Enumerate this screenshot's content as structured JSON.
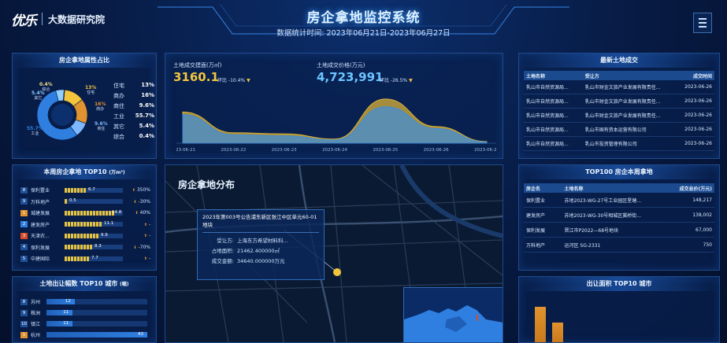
{
  "header": {
    "logo": "优乐",
    "org": "大数据研究院",
    "title": "房企拿地监控系统",
    "subtitle": "数据统计时间:  2023年06月21日-2023年06月27日"
  },
  "attr_panel": {
    "title": "房企拿地属性占比",
    "legend": [
      {
        "label": "住宅",
        "value": "13%"
      },
      {
        "label": "商办",
        "value": "16%"
      },
      {
        "label": "商住",
        "value": "9.6%"
      },
      {
        "label": "工业",
        "value": "55.7%"
      },
      {
        "label": "其它",
        "value": "5.4%"
      },
      {
        "label": "综合",
        "value": "0.4%"
      }
    ],
    "donut_labels": [
      {
        "value": "0.4%",
        "label": "综合"
      },
      {
        "value": "5.4%",
        "label": "其它"
      },
      {
        "value": "13%",
        "label": "住宅"
      },
      {
        "value": "16%",
        "label": "商办"
      },
      {
        "value": "9.6%",
        "label": "商住"
      },
      {
        "value": "55.7%",
        "label": "工业"
      }
    ],
    "colors": [
      "#f2c53d",
      "#e0932e",
      "#7bb8ff",
      "#2f7fe0",
      "#8fd0ff",
      "#f7e28a"
    ]
  },
  "chart_panel": {
    "area_label": "土地成交建面(万㎡)",
    "area_value": "3160.1",
    "area_change": "环比 -10.4%",
    "price_label": "土地成交价格(万元)",
    "price_value": "4,723,991",
    "price_change": "环比 -26.5%"
  },
  "chart_data": {
    "type": "area",
    "categories": [
      "2023-06-21",
      "2023-06-22",
      "2023-06-23",
      "2023-06-24",
      "2023-06-25",
      "2023-06-26",
      "2023-06-27"
    ],
    "series": [
      {
        "values": [
          60,
          20,
          18,
          8,
          85,
          32,
          3
        ],
        "color": "#d8b23a"
      },
      {
        "values": [
          55,
          16,
          14,
          6,
          70,
          28,
          2
        ],
        "color": "#3d8ee0"
      }
    ],
    "ylim": [
      0,
      100
    ]
  },
  "latest_panel": {
    "title": "最新土地成交",
    "columns": [
      "土地名称",
      "受让方",
      "成交时间"
    ],
    "rows": [
      [
        "乳山市自然资源局...",
        "乳山市财金文旅产业发展有限责任...",
        "2023-06-26"
      ],
      [
        "乳山市自然资源局...",
        "乳山市财金文旅产业发展有限责任...",
        "2023-06-26"
      ],
      [
        "乳山市自然资源局...",
        "乳山市财金文旅产业发展有限责任...",
        "2023-06-26"
      ],
      [
        "乳山市自然资源局...",
        "乳山市国有资本运营有限公司",
        "2023-06-26"
      ],
      [
        "乳山市自然资源局...",
        "乳山市投资管理有限公司",
        "2023-06-26"
      ]
    ]
  },
  "top10_panel": {
    "title": "本周房企拿地 TOP10",
    "unit": "(万m²)",
    "rows": [
      {
        "rank": "8",
        "name": "保利置业",
        "value": "6.7",
        "change": "350%",
        "dir": "up",
        "fill": 0.45,
        "rank_color": "#1f4f96"
      },
      {
        "rank": "9",
        "name": "万科地产",
        "value": "0.5",
        "change": "-30%",
        "dir": "down",
        "fill": 0.04,
        "rank_color": "#1f4f96"
      },
      {
        "rank": "1",
        "name": "城建发展",
        "value": "14.8",
        "change": "40%",
        "dir": "up",
        "fill": 1.0,
        "rank_color": "#e0932e"
      },
      {
        "rank": "2",
        "name": "建发房产",
        "value": "11.1",
        "change": "-",
        "dir": "none",
        "fill": 0.75,
        "rank_color": "#2f7fe0"
      },
      {
        "rank": "3",
        "name": "天津农...",
        "value": "9.9",
        "change": "-",
        "dir": "none",
        "fill": 0.67,
        "rank_color": "#d84b2a"
      },
      {
        "rank": "4",
        "name": "保利发展",
        "value": "8.3",
        "change": "-70%",
        "dir": "down",
        "fill": 0.56,
        "rank_color": "#1f4f96"
      },
      {
        "rank": "5",
        "name": "中建国际",
        "value": "7.7",
        "change": "-",
        "dir": "none",
        "fill": 0.52,
        "rank_color": "#1f4f96"
      }
    ]
  },
  "map_panel": {
    "title": "房企拿地分布",
    "popup_title": "2023年第003号公告浦东新区张江中区单元60-01地块",
    "fields": [
      {
        "label": "受让方:",
        "value": "上海东方希望材料科..."
      },
      {
        "label": "占地面积:",
        "value": "21462.400000㎡"
      },
      {
        "label": "成交金额:",
        "value": "34640.000000万元"
      }
    ]
  },
  "top100_panel": {
    "title": "TOP100 房企本周拿地",
    "columns": [
      "房企名",
      "土地名称",
      "成交总价(万元)"
    ],
    "rows": [
      [
        "保利置业",
        "苏地2023-WG-27号工业园区星塘...",
        "148,217"
      ],
      [
        "建发房产",
        "苏地2023-WG-30号相城区冀桥街...",
        "138,002"
      ],
      [
        "保利发展",
        "晋江市P2022—68号地块",
        "67,000"
      ],
      [
        "万科地产",
        "运河区 SG-2331",
        "750"
      ]
    ]
  },
  "city_panel": {
    "title": "土地出让幅数 TOP10 城市",
    "unit": "(幅)",
    "rows": [
      {
        "rank": "8",
        "name": "苏州",
        "value": "12",
        "fill": 0.28
      },
      {
        "rank": "9",
        "name": "株洲",
        "value": "11",
        "fill": 0.26
      },
      {
        "rank": "10",
        "name": "镇江",
        "value": "11",
        "fill": 0.26
      },
      {
        "rank": "1",
        "name": "杭州",
        "value": "43",
        "fill": 1.0
      }
    ]
  },
  "sell_panel": {
    "title": "出让面积 TOP10 城市"
  }
}
